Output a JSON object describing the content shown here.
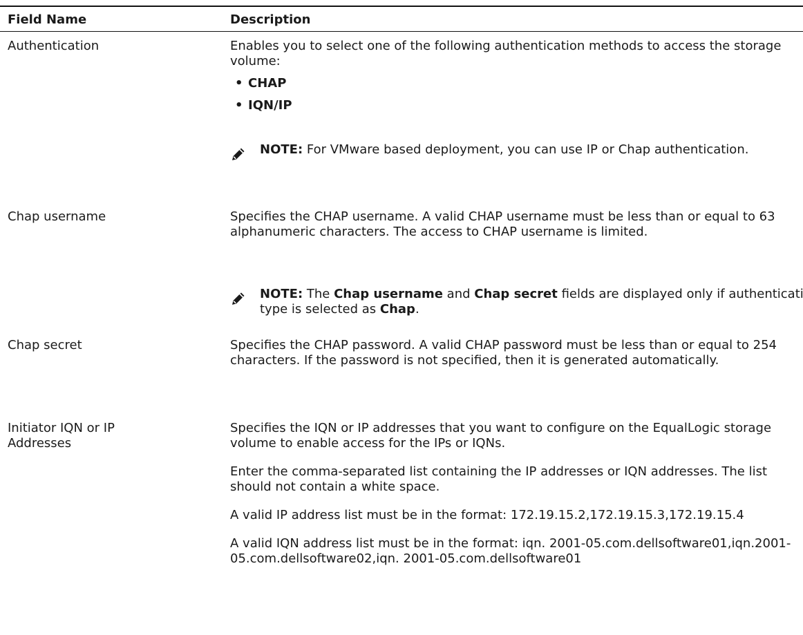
{
  "table": {
    "headers": {
      "field_name": "Field Name",
      "description": "Description"
    },
    "rows": [
      {
        "field": "Authentication",
        "desc": "Enables you to select one of the following authentication methods to access the storage volume:",
        "bullets": [
          "CHAP",
          "IQN/IP"
        ],
        "note": {
          "label": "NOTE:",
          "text": " For VMware based deployment, you can use IP or Chap authentication."
        }
      },
      {
        "field": "Chap username",
        "desc": "Specifies the CHAP username. A valid CHAP username must be less than or equal to 63 alphanumeric characters. The access to CHAP username is limited.",
        "note": {
          "label": "NOTE:",
          "t1": " The ",
          "b1": "Chap username",
          "t2": " and ",
          "b2": "Chap secret",
          "t3": " fields are displayed only if authentication type is selected as ",
          "b3": "Chap",
          "t4": "."
        }
      },
      {
        "field": "Chap secret",
        "desc": "Specifies the CHAP password. A valid CHAP password must be less than or equal to 254 characters. If the password is not specified, then it is generated automatically."
      },
      {
        "field": "Initiator IQN or IP Addresses",
        "paragraphs": [
          "Specifies the IQN or IP addresses that you want to configure on the EqualLogic storage volume to enable access for the IPs or IQNs.",
          "Enter the comma-separated list containing the IP addresses or IQN addresses. The list should not contain a white space.",
          "A valid IP address list must be in the format: 172.19.15.2,172.19.15.3,172.19.15.4",
          "A valid IQN address list must be in the format: iqn. 2001-05.com.dellsoftware01,iqn.2001-05.com.dellsoftware02,iqn. 2001-05.com.dellsoftware01"
        ]
      }
    ]
  },
  "icons": {
    "note": "pencil-icon"
  }
}
